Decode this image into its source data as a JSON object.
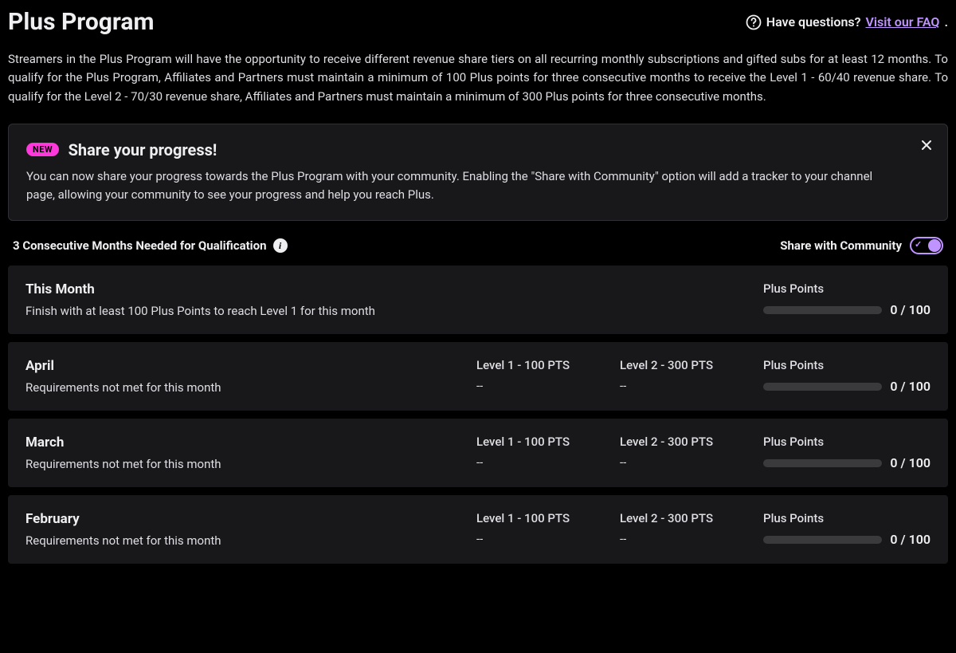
{
  "header": {
    "title": "Plus Program",
    "faq_prefix": "Have questions? ",
    "faq_link": "Visit our FAQ",
    "faq_suffix": "."
  },
  "intro": "Streamers in the Plus Program will have the opportunity to receive different revenue share tiers on all recurring monthly subscriptions and gifted subs for at least 12 months. To qualify for the Plus Program, Affiliates and Partners must maintain a minimum of 100 Plus points for three consecutive months to receive the Level 1 - 60/40 revenue share. To qualify for the Level 2 - 70/30 revenue share, Affiliates and Partners must maintain a minimum of 300 Plus points for three consecutive months.",
  "banner": {
    "badge": "NEW",
    "title": "Share your progress!",
    "body": "You can now share your progress towards the Plus Program with your community. Enabling the \"Share with Community\" option will add a tracker to your channel page, allowing your community to see your progress and help you reach Plus."
  },
  "controls": {
    "qualification_label": "3 Consecutive Months Needed for Qualification",
    "share_label": "Share with Community"
  },
  "points_header": "Plus Points",
  "level1_header": "Level 1 - 100 PTS",
  "level2_header": "Level 2 - 300 PTS",
  "months": {
    "current": {
      "name": "This Month",
      "subtitle": "Finish with at least 100 Plus Points to reach Level 1 for this month",
      "points": "0 / 100"
    },
    "past": [
      {
        "name": "April",
        "subtitle": "Requirements not met for this month",
        "level1": "--",
        "level2": "--",
        "points": "0 / 100"
      },
      {
        "name": "March",
        "subtitle": "Requirements not met for this month",
        "level1": "--",
        "level2": "--",
        "points": "0 / 100"
      },
      {
        "name": "February",
        "subtitle": "Requirements not met for this month",
        "level1": "--",
        "level2": "--",
        "points": "0 / 100"
      }
    ]
  }
}
